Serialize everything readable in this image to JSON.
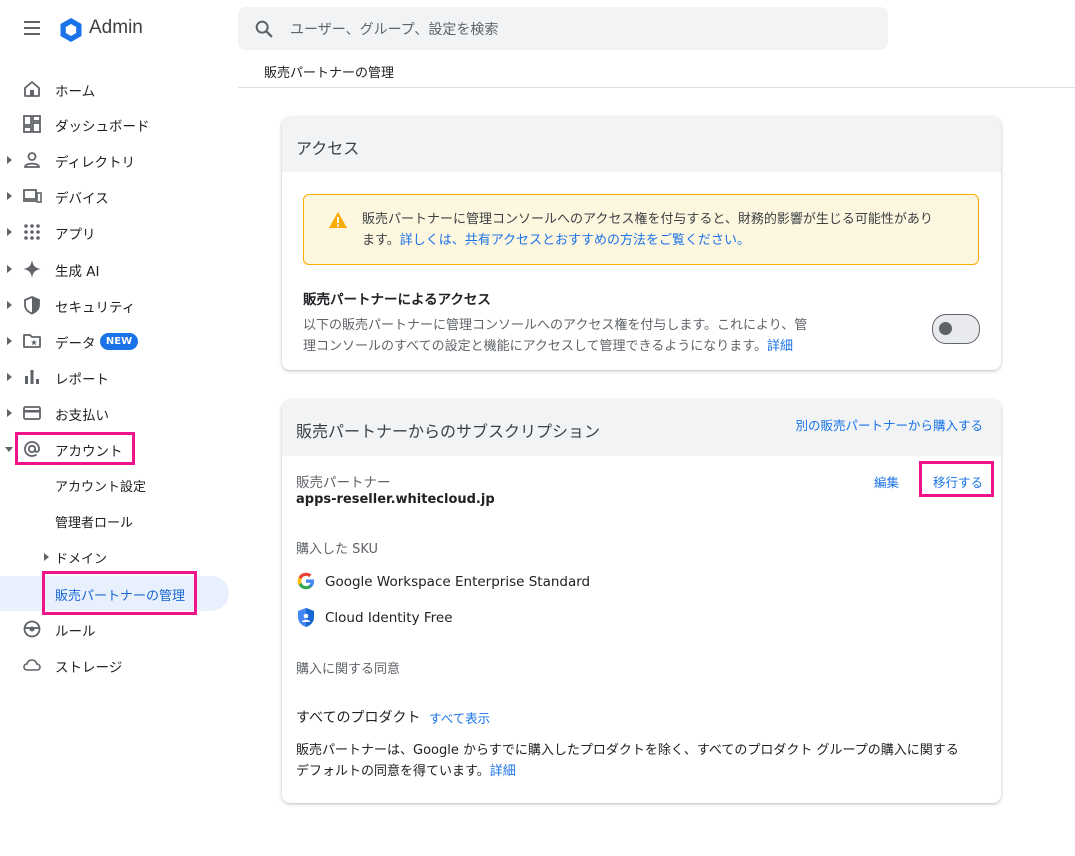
{
  "app": {
    "brand": "Admin",
    "search_placeholder": "ユーザー、グループ、設定を検索",
    "breadcrumb": "販売パートナーの管理"
  },
  "sidebar": {
    "items": [
      {
        "label": "ホーム",
        "icon": "home-icon"
      },
      {
        "label": "ダッシュボード",
        "icon": "dashboard-icon"
      },
      {
        "label": "ディレクトリ",
        "icon": "person-icon"
      },
      {
        "label": "デバイス",
        "icon": "devices-icon"
      },
      {
        "label": "アプリ",
        "icon": "apps-grid-icon"
      },
      {
        "label": "生成 AI",
        "icon": "sparkle-icon"
      },
      {
        "label": "セキュリティ",
        "icon": "shield-icon"
      },
      {
        "label": "データ",
        "icon": "data-folder-icon",
        "badge": "NEW"
      },
      {
        "label": "レポート",
        "icon": "bar-chart-icon"
      },
      {
        "label": "お支払い",
        "icon": "credit-card-icon"
      },
      {
        "label": "アカウント",
        "icon": "at-sign-icon"
      },
      {
        "label": "ルール",
        "icon": "rules-icon"
      },
      {
        "label": "ストレージ",
        "icon": "cloud-icon"
      }
    ],
    "account_sub": [
      {
        "label": "アカウント設定"
      },
      {
        "label": "管理者ロール"
      },
      {
        "label": "ドメイン"
      },
      {
        "label": "販売パートナーの管理"
      }
    ]
  },
  "access_card": {
    "title": "アクセス",
    "warning_text": "販売パートナーに管理コンソールへのアクセス権を付与すると、財務的影響が生じる可能性があり",
    "warning_text_2": "ます。",
    "warning_link": "詳しくは、共有アクセスとおすすめの方法をご覧ください。",
    "section_title": "販売パートナーによるアクセス",
    "desc_line1": "以下の販売パートナーに管理コンソールへのアクセス権を付与します。これにより、管",
    "desc_line2": "理コンソールのすべての設定と機能にアクセスして管理できるようになります。",
    "desc_link": "詳細",
    "toggle_on": false
  },
  "subs_card": {
    "title": "販売パートナーからのサブスクリプション",
    "buy_link": "別の販売パートナーから購入する",
    "reseller_label": "販売パートナー",
    "reseller_domain": "apps-reseller.whitecloud.jp",
    "edit_link": "編集",
    "transfer_link": "移行する",
    "sku_label": "購入した SKU",
    "skus": [
      {
        "name": "Google Workspace Enterprise Standard",
        "icon": "google-g-icon"
      },
      {
        "name": "Cloud Identity Free",
        "icon": "cloud-identity-shield-icon"
      }
    ],
    "consent_label": "購入に関する同意",
    "all_products_label": "すべてのプロダクト",
    "show_all_link": "すべて表示",
    "consent_line1": "販売パートナーは、Google からすでに購入したプロダクトを除く、すべてのプロダクト グループの購入に関する",
    "consent_line2": "デフォルトの同意を得ています。",
    "consent_link": "詳細"
  },
  "colors": {
    "accent": "#1a73e8",
    "highlight": "#f0148c",
    "warning_bg": "#fef7e0",
    "warning_border": "#f9ab00"
  }
}
